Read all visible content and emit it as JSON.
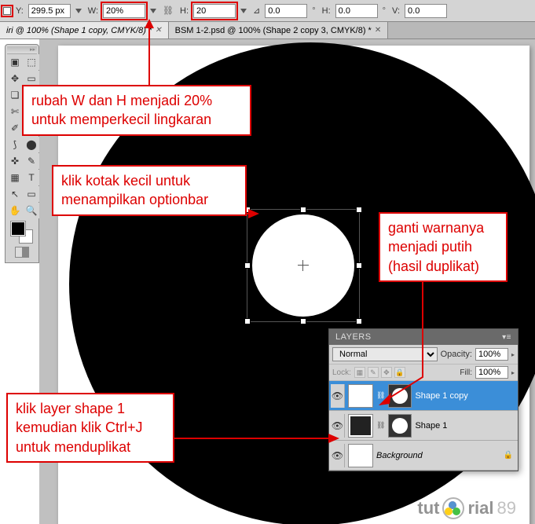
{
  "options_bar": {
    "y_label": "Y:",
    "y_value": "299.5 px",
    "w_label": "W:",
    "w_value": "20%",
    "h_label": "H:",
    "h_value": "20",
    "angle_label": "⊿",
    "angle_value": "0.0",
    "h_skew_label": "H:",
    "h_skew_value": "0.0",
    "v_skew_label": "V:",
    "v_skew_value": "0.0"
  },
  "tabs": {
    "tab1": "iri @ 100% (Shape 1 copy, CMYK/8) *",
    "tab2": "BSM 1-2.psd @ 100% (Shape 2 copy 3, CMYK/8) *"
  },
  "toolbox": {
    "t0": "▣",
    "t1": "⬚",
    "t2": "✥",
    "t3": "▭",
    "t4": "❏",
    "t5": "✎",
    "t6": "✄",
    "t7": "⌕",
    "t8": "✐",
    "t9": "✚",
    "t10": "⟆",
    "t11": "⬤",
    "t12": "✜",
    "t13": "✎",
    "t14": "▦",
    "t15": "◐",
    "t16": "∿",
    "t17": "T",
    "t18": "↖",
    "t19": "▭",
    "t20": "✋",
    "t21": "🔍",
    "t22": "⟲",
    "t23": "⬚"
  },
  "layers_panel": {
    "title": "LAYERS",
    "blend_mode": "Normal",
    "opacity_label": "Opacity:",
    "opacity_value": "100%",
    "lock_label": "Lock:",
    "fill_label": "Fill:",
    "fill_value": "100%",
    "layer1_name": "Shape 1 copy",
    "layer2_name": "Shape 1",
    "layer3_name": "Background",
    "lock_icon": "🔒"
  },
  "annotations": {
    "a1": "rubah W dan H menjadi 20% untuk memperkecil lingkaran",
    "a2": "klik kotak kecil untuk menampilkan optionbar",
    "a3": "ganti warnanya menjadi putih (hasil duplikat)",
    "a4": "klik layer shape 1 kemudian klik Ctrl+J untuk menduplikat"
  },
  "watermark": {
    "pre": "tut",
    "post": "rial",
    "num": "89"
  }
}
